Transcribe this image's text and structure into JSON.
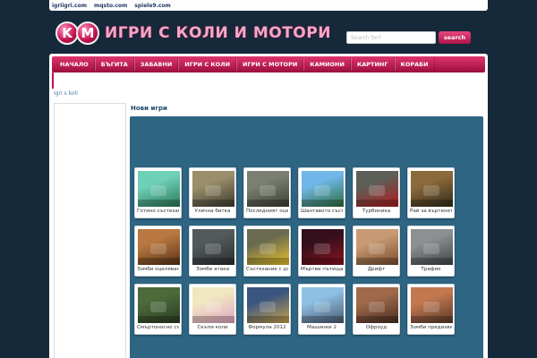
{
  "topbar": {
    "links": [
      "igriigri.com",
      "mqsto.com",
      "spiele9.com"
    ]
  },
  "logo": {
    "letter1": "K",
    "letter2": "M",
    "title": "ИГРИ С КОЛИ И МОТОРИ"
  },
  "search": {
    "placeholder": "Search for?",
    "button_label": "search"
  },
  "nav": {
    "items": [
      "НАЧАЛО",
      "БЪГИТА",
      "ЗАБАВНИ",
      "ИГРИ С КОЛИ",
      "ИГРИ С МОТОРИ",
      "КАМИОНИ",
      "КАРТИНГ",
      "КОРАБИ"
    ]
  },
  "breadcrumb": "Igri s koli",
  "section_title": "Нови игри",
  "games": [
    {
      "name": "Готино състезание",
      "colors": [
        "#6fd0b8",
        "#2a7a58"
      ]
    },
    {
      "name": "Улична битка",
      "colors": [
        "#9a8f6a",
        "#3d3a30"
      ]
    },
    {
      "name": "Последният оцелял",
      "colors": [
        "#7b7f72",
        "#3b3f32"
      ]
    },
    {
      "name": "Шантавото състезание",
      "colors": [
        "#6fb7e8",
        "#2d6d3e"
      ]
    },
    {
      "name": "Турбоника",
      "colors": [
        "#5c5f58",
        "#b11c1c"
      ]
    },
    {
      "name": "Рай за въртенето",
      "colors": [
        "#8a6a3a",
        "#33291a"
      ]
    },
    {
      "name": "Зомби оцеляване",
      "colors": [
        "#b87840",
        "#5a3315"
      ]
    },
    {
      "name": "Зомби атака",
      "colors": [
        "#545a5a",
        "#2a2f30"
      ]
    },
    {
      "name": "Състезание с джипове",
      "colors": [
        "#6a6a50",
        "#e8c12a"
      ]
    },
    {
      "name": "Мъртви пътища",
      "colors": [
        "#34101c",
        "#8a1220"
      ]
    },
    {
      "name": "Дрифт",
      "colors": [
        "#c89a74",
        "#7a4e2e"
      ]
    },
    {
      "name": "Трафик",
      "colors": [
        "#8c9090",
        "#3f4444"
      ]
    },
    {
      "name": "Смъртоносно състезание",
      "colors": [
        "#4c6a3a",
        "#2a3e24"
      ]
    },
    {
      "name": "Скъпи коли",
      "colors": [
        "#f0e7c0",
        "#e2a6c4"
      ]
    },
    {
      "name": "Формула 2012",
      "colors": [
        "#3a5580",
        "#c9a24a"
      ]
    },
    {
      "name": "Машинки 2",
      "colors": [
        "#8dc0e4",
        "#4a5a70"
      ]
    },
    {
      "name": "Офроуд",
      "colors": [
        "#a06a4a",
        "#4a2e20"
      ]
    },
    {
      "name": "Зомби предизвикателство",
      "colors": [
        "#c47850",
        "#5a3a2a"
      ]
    }
  ]
}
